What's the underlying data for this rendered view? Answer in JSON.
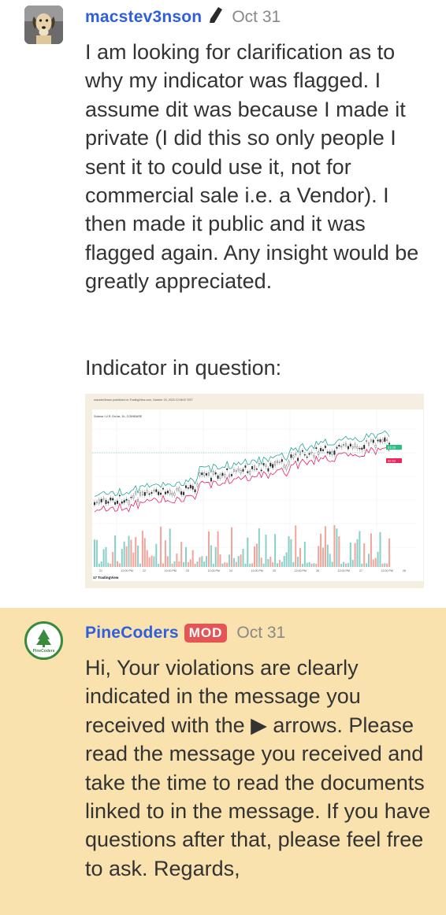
{
  "posts": [
    {
      "author": "macstev3nson",
      "date": "Oct 31",
      "paragraph1": "I am looking for clarification as to why my indicator was flagged. I assume dit was because I made it private (I did this so only people I sent it to could use it, not for commercial sale i.e. a Vendor). I then made it public and it was flagged again. Any insight would be greatly appreciated.",
      "paragraph2": "Indicator in question:",
      "image": {
        "header_line": "macstev3nson published on TradingView.com, October 23, 2023 12:08:57 EST",
        "symbol_line": "Solana / U.S. Dollar, 1h, COINBASE",
        "price_tag_top": "33.28",
        "price_tag_bottom": "32.63",
        "brand": "TradingView",
        "x_ticks": [
          "21",
          "12:00 PM",
          "22",
          "12:00 PM",
          "23",
          "12:00 PM",
          "24",
          "12:00 PM",
          "25",
          "12:00 PM",
          "26",
          "12:00 PM",
          "27",
          "12:00 PM",
          "28"
        ]
      }
    },
    {
      "author": "PineCoders",
      "badge": "MOD",
      "date": "Oct 31",
      "logo_text": "PineCoders",
      "paragraph1_a": "Hi, Your violations are clearly indicated in the message you received with the",
      "arrow_glyph": "▶",
      "paragraph1_b": "arrows. Please read the message you received and take the time to read the documents linked to in the message. If you have questions after that, please feel free to ask. Regards,"
    }
  ],
  "colors": {
    "username": "#2f5fde",
    "mod_badge": "#e45656",
    "mod_post_bg": "#f9e2ae",
    "pinecoders_green": "#3a8a3e"
  }
}
